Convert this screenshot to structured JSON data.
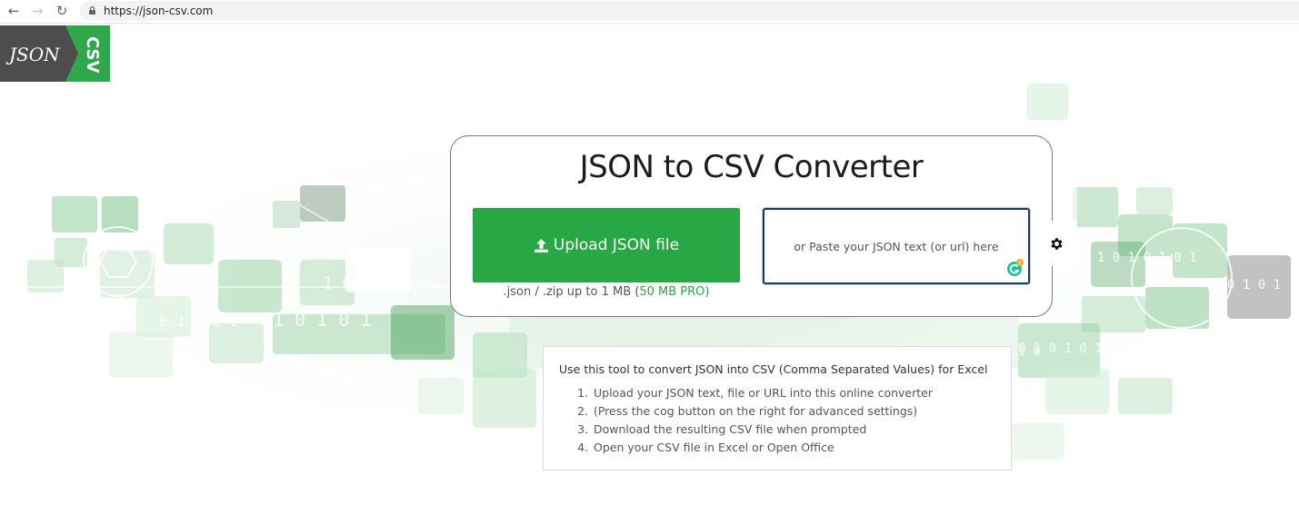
{
  "browser": {
    "url": "https://json-csv.com",
    "back_icon": "←",
    "forward_icon": "→",
    "reload_icon": "↻"
  },
  "logo": {
    "left_text": "JSON",
    "right_text": "CSV",
    "colors": {
      "dark": "#4d4d4d",
      "green": "#2ea84a"
    }
  },
  "converter": {
    "title": "JSON to CSV Converter",
    "upload_label": "Upload JSON file",
    "upload_hint_prefix": ".json / .zip up to 1 MB (",
    "upload_hint_pro": "50 MB PRO",
    "upload_hint_suffix": ")",
    "paste_placeholder": "or Paste your JSON text (or url) here"
  },
  "instructions": {
    "heading": "Use this tool to convert JSON into CSV (Comma Separated Values) for Excel",
    "steps": [
      {
        "num": "1.",
        "text": "Upload your JSON text, file or URL into this online converter"
      },
      {
        "num": "2.",
        "text": "(Press the cog button on the right for advanced settings)"
      },
      {
        "num": "3.",
        "text": "Download the resulting CSV file when prompted"
      },
      {
        "num": "4.",
        "text": "Open your CSV file in Excel or Open Office"
      }
    ]
  },
  "colors": {
    "accent_green": "#28a745",
    "paste_border": "#1e3a63",
    "card_border": "#7a7a7a"
  },
  "icons": {
    "upload": "upload-icon",
    "settings": "cog-icon",
    "grammarly": "grammarly-icon",
    "lock": "lock-icon"
  }
}
